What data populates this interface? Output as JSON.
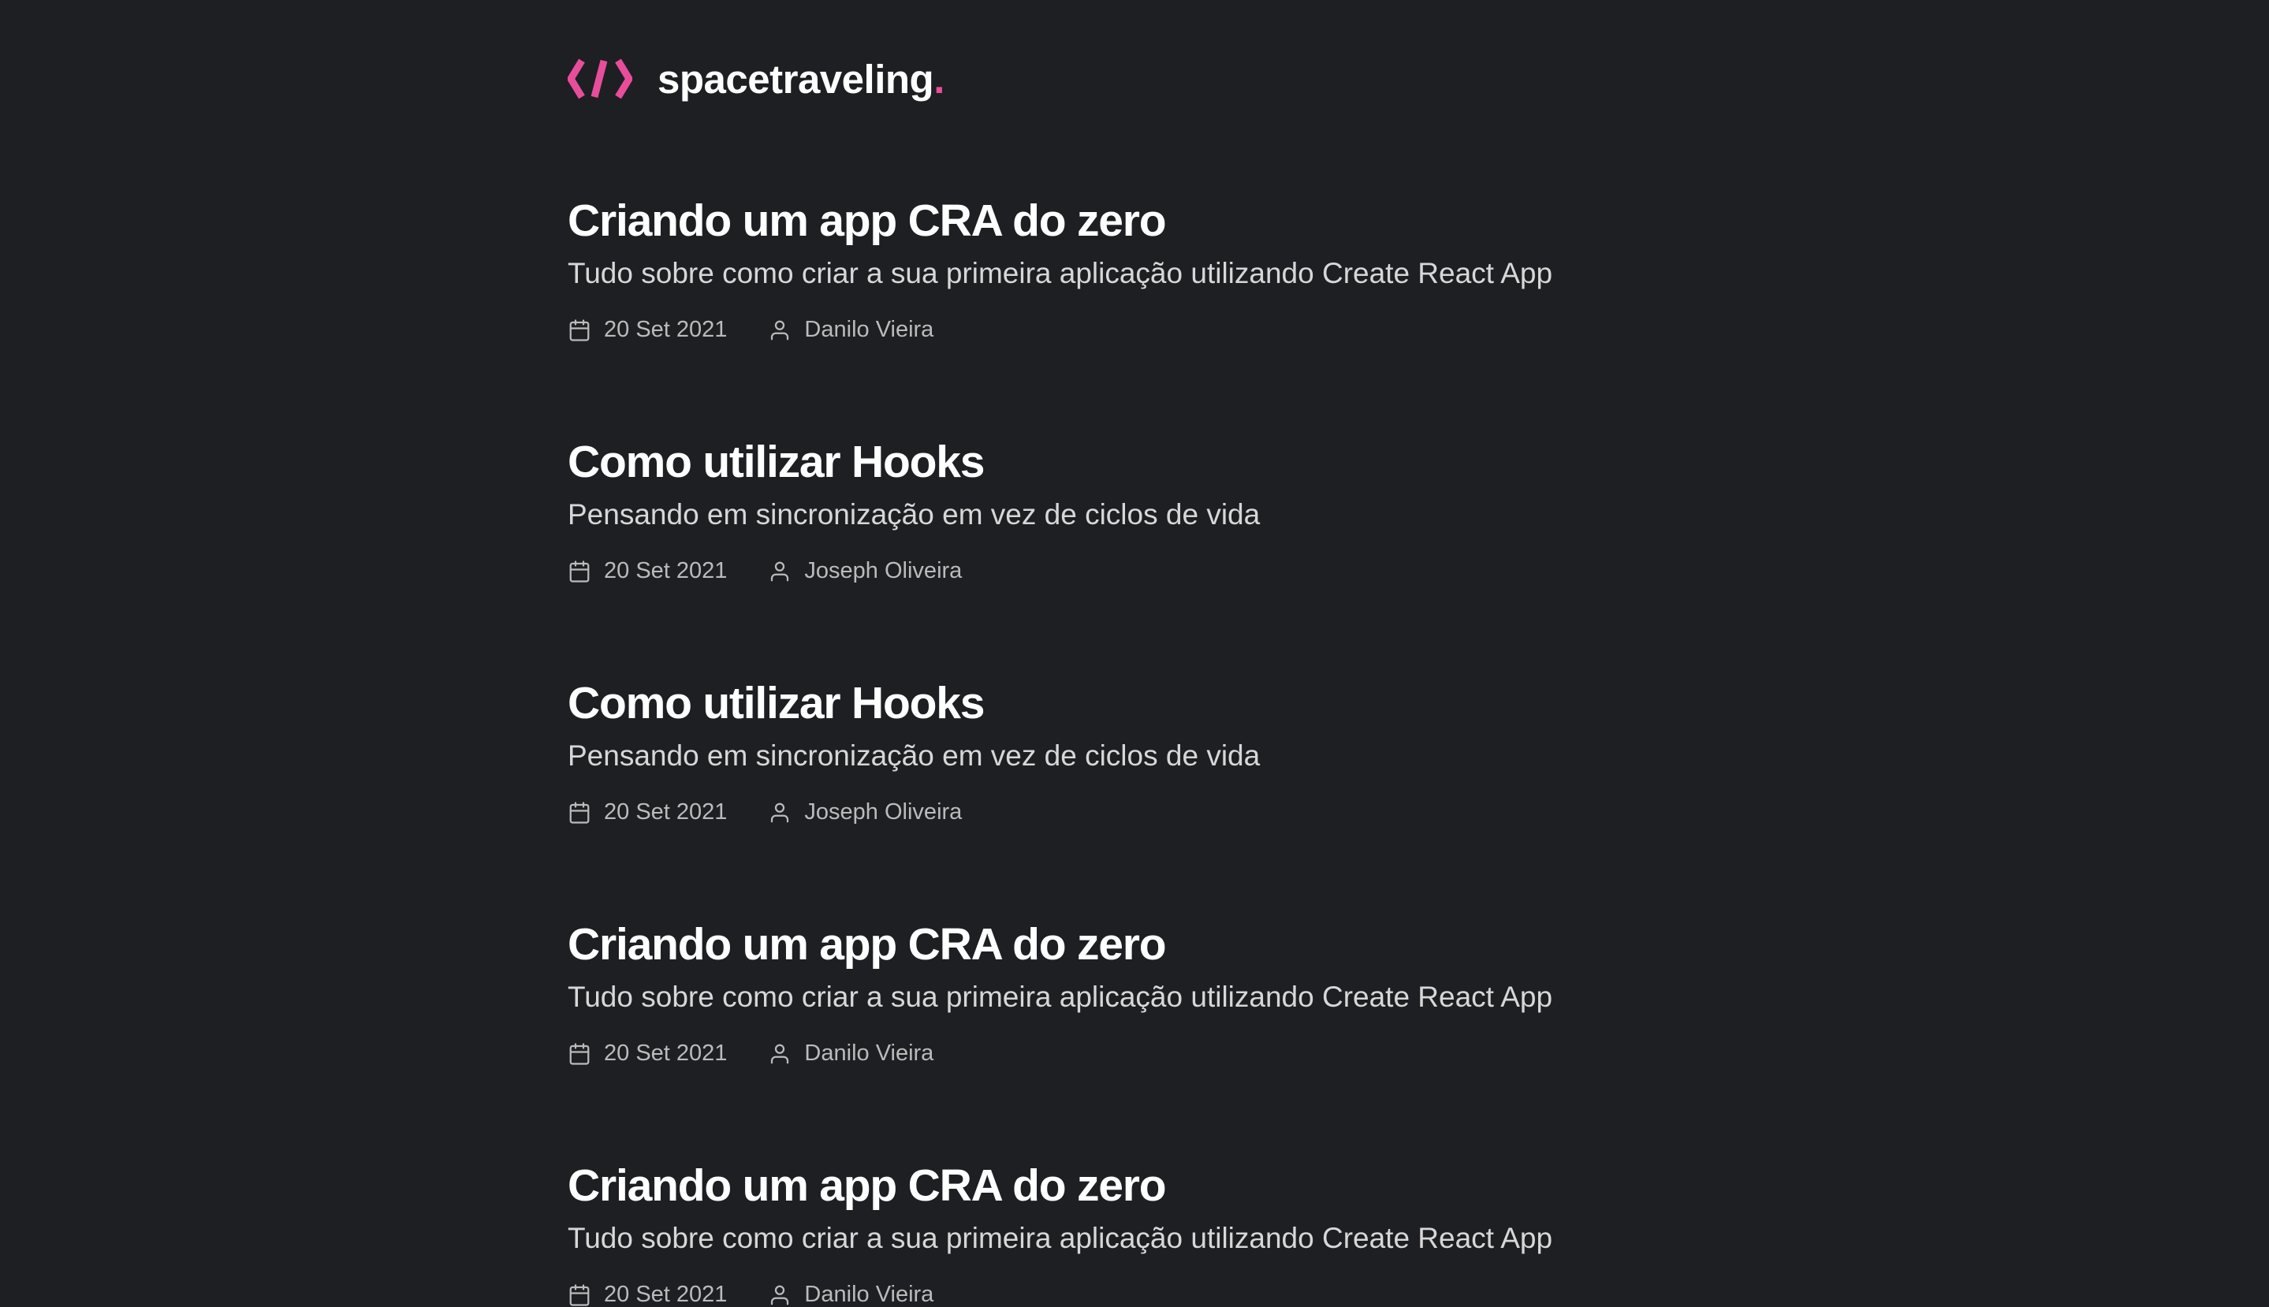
{
  "header": {
    "logo_icon": "code-brackets-icon",
    "brand": "spacetraveling",
    "brand_dot": ".",
    "accent_color": "#e84d9c"
  },
  "posts": [
    {
      "title": "Criando um app CRA do zero",
      "subtitle": "Tudo sobre como criar a sua primeira aplicação utilizando Create React App",
      "date": "20 Set 2021",
      "author": "Danilo Vieira"
    },
    {
      "title": "Como utilizar Hooks",
      "subtitle": "Pensando em sincronização em vez de ciclos de vida",
      "date": "20 Set 2021",
      "author": "Joseph Oliveira"
    },
    {
      "title": "Como utilizar Hooks",
      "subtitle": "Pensando em sincronização em vez de ciclos de vida",
      "date": "20 Set 2021",
      "author": "Joseph Oliveira"
    },
    {
      "title": "Criando um app CRA do zero",
      "subtitle": "Tudo sobre como criar a sua primeira aplicação utilizando Create React App",
      "date": "20 Set 2021",
      "author": "Danilo Vieira"
    },
    {
      "title": "Criando um app CRA do zero",
      "subtitle": "Tudo sobre como criar a sua primeira aplicação utilizando Create React App",
      "date": "20 Set 2021",
      "author": "Danilo Vieira"
    }
  ],
  "icons": {
    "date": "calendar-icon",
    "author": "user-icon"
  },
  "colors": {
    "background": "#1e1f23",
    "title": "#ffffff",
    "subtitle": "#d7d7d7",
    "meta": "#bbbbbb"
  }
}
